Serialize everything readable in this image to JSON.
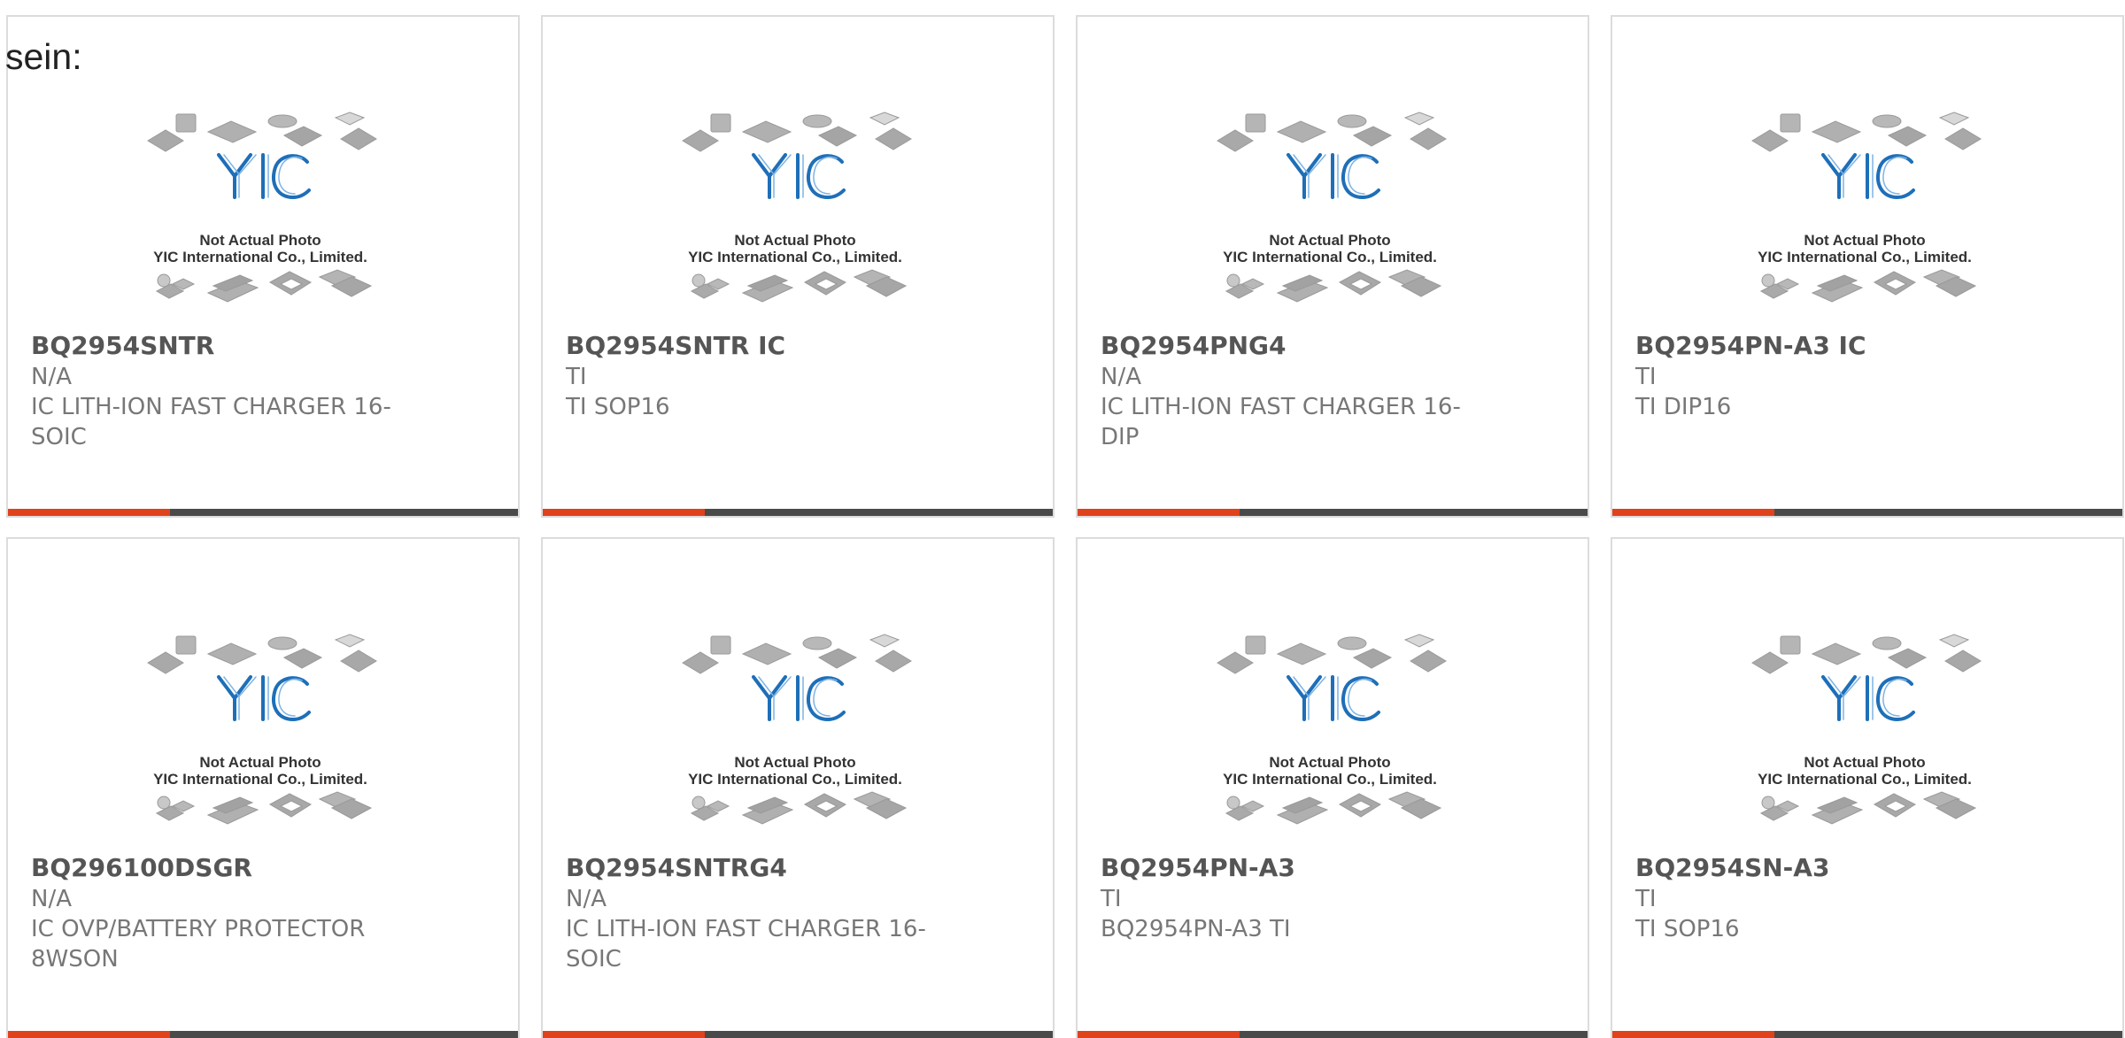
{
  "page": {
    "intro_text": "sein:"
  },
  "placeholder": {
    "line1": "Not Actual Photo",
    "line2": "YIC International Co., Limited.",
    "logo_text": "YIC"
  },
  "colors": {
    "accent": "#e0421c",
    "bar_dark": "#4a4a4a",
    "logo_blue": "#1e6fb8",
    "chip_gray": "#a9a9a9"
  },
  "products": [
    {
      "name": "BQ2954SNTR",
      "manufacturer": "N/A",
      "description": "IC LITH-ION FAST CHARGER 16-SOIC"
    },
    {
      "name": "BQ2954SNTR IC",
      "manufacturer": "TI",
      "description": "TI SOP16"
    },
    {
      "name": "BQ2954PNG4",
      "manufacturer": "N/A",
      "description": "IC LITH-ION FAST CHARGER 16-DIP"
    },
    {
      "name": "BQ2954PN-A3 IC",
      "manufacturer": "TI",
      "description": "TI DIP16"
    },
    {
      "name": "BQ296100DSGR",
      "manufacturer": "N/A",
      "description": "IC OVP/BATTERY PROTECTOR 8WSON"
    },
    {
      "name": "BQ2954SNTRG4",
      "manufacturer": "N/A",
      "description": "IC LITH-ION FAST CHARGER 16-SOIC"
    },
    {
      "name": "BQ2954PN-A3",
      "manufacturer": "TI",
      "description": "BQ2954PN-A3 TI"
    },
    {
      "name": "BQ2954SN-A3",
      "manufacturer": "TI",
      "description": "TI SOP16"
    }
  ]
}
